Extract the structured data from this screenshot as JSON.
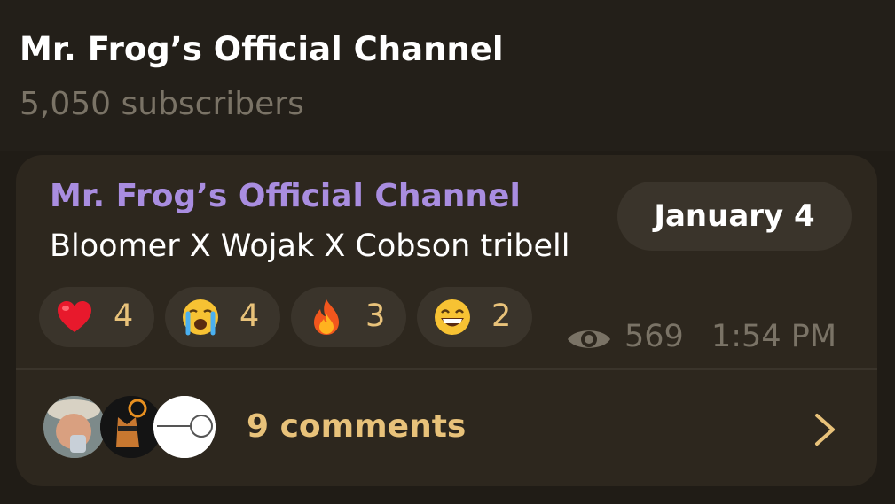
{
  "channel": {
    "title": "Mr. Frog’s Official Channel",
    "subscribers": "5,050 subscribers"
  },
  "post": {
    "author": "Mr. Frog’s Official Channel",
    "text": "Bloomer X Wojak X Cobson tribell",
    "date_badge": "January 4",
    "reactions": [
      {
        "icon": "red-heart-icon",
        "count": "4"
      },
      {
        "icon": "crying-face-icon",
        "count": "4"
      },
      {
        "icon": "fire-icon",
        "count": "3"
      },
      {
        "icon": "grinning-face-icon",
        "count": "2"
      }
    ],
    "views": "569",
    "time": "1:54 PM",
    "comments_label": "9 comments",
    "commenter_avatars": [
      "avatar-1",
      "avatar-2",
      "avatar-3"
    ]
  },
  "colors": {
    "background": "#201c16",
    "bubble": "#2d271e",
    "author_accent": "#a98de0",
    "reaction_count": "#e8c27a",
    "muted_text": "#7a7366"
  }
}
